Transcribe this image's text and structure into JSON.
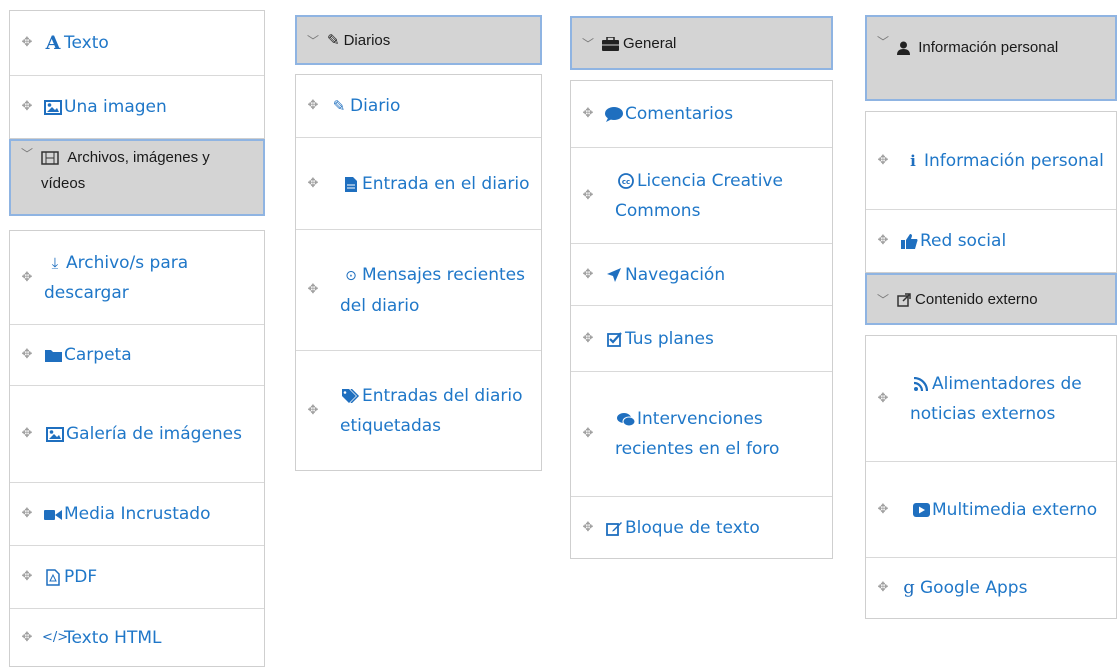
{
  "col1": {
    "items_top": [
      {
        "label": "Texto",
        "icon": "font-icon"
      },
      {
        "label": "Una imagen",
        "icon": "image-icon"
      }
    ],
    "header": {
      "label": "Archivos, imágenes y vídeos",
      "icon": "film-icon"
    },
    "items": [
      {
        "label": "Archivo/s para descargar",
        "icon": "download-icon"
      },
      {
        "label": "Carpeta",
        "icon": "folder-icon"
      },
      {
        "label": "Galería de imágenes",
        "icon": "image-icon"
      },
      {
        "label": "Media Incrustado",
        "icon": "video-camera-icon"
      },
      {
        "label": "PDF",
        "icon": "pdf-file-icon"
      },
      {
        "label": "Texto HTML",
        "icon": "code-icon"
      }
    ]
  },
  "col2": {
    "header": {
      "label": "Diarios",
      "icon": "pencil-icon"
    },
    "items": [
      {
        "label": "Diario",
        "icon": "pencil-icon"
      },
      {
        "label": "Entrada en el diario",
        "icon": "file-text-icon"
      },
      {
        "label": "Mensajes recientes del diario",
        "icon": "clock-icon"
      },
      {
        "label": "Entradas del diario etiquetadas",
        "icon": "tags-icon"
      }
    ]
  },
  "col3": {
    "header": {
      "label": "General",
      "icon": "briefcase-icon"
    },
    "items": [
      {
        "label": "Comentarios",
        "icon": "comment-icon"
      },
      {
        "label": "Licencia Creative Commons",
        "icon": "creative-commons-icon"
      },
      {
        "label": "Navegación",
        "icon": "location-arrow-icon"
      },
      {
        "label": "Tus planes",
        "icon": "check-square-icon"
      },
      {
        "label": "Intervenciones recientes en el foro",
        "icon": "comments-icon"
      },
      {
        "label": "Bloque de texto",
        "icon": "edit-icon"
      }
    ]
  },
  "col4": {
    "header1": {
      "label": "Información personal",
      "icon": "user-icon"
    },
    "items1": [
      {
        "label": "Información personal",
        "icon": "info-icon"
      },
      {
        "label": "Red social",
        "icon": "thumbs-up-icon"
      }
    ],
    "header2": {
      "label": "Contenido externo",
      "icon": "external-link-icon"
    },
    "items2": [
      {
        "label": "Alimentadores de noticias externos",
        "icon": "rss-icon"
      },
      {
        "label": "Multimedia externo",
        "icon": "youtube-play-icon"
      },
      {
        "label": "Google Apps",
        "icon": "google-icon"
      }
    ]
  },
  "colors": {
    "link": "#1f77c8",
    "header_bg": "#d4d4d4",
    "header_border": "#8fb4e2"
  }
}
